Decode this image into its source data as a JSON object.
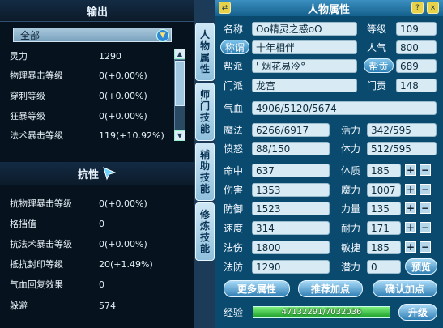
{
  "output_panel": {
    "title": "输出",
    "dropdown": "全部",
    "rows": [
      {
        "label": "灵力",
        "value": "1290"
      },
      {
        "label": "物理暴击等级",
        "value": "0(+0.00%)"
      },
      {
        "label": "穿刺等级",
        "value": "0(+0.00%)"
      },
      {
        "label": "狂暴等级",
        "value": "0(+0.00%)"
      },
      {
        "label": "法术暴击等级",
        "value": "119(+10.92%)"
      }
    ]
  },
  "defense_panel": {
    "title": "抗性",
    "rows": [
      {
        "label": "抗物理暴击等级",
        "value": "0(+0.00%)"
      },
      {
        "label": "格挡值",
        "value": "0"
      },
      {
        "label": "抗法术暴击等级",
        "value": "0(+0.00%)"
      },
      {
        "label": "抵抗封印等级",
        "value": "20(+1.49%)"
      },
      {
        "label": "气血回复效果",
        "value": "0"
      },
      {
        "label": "躲避",
        "value": "574"
      }
    ]
  },
  "side_tabs": [
    "人物属性",
    "师门技能",
    "辅助技能",
    "修炼技能"
  ],
  "window": {
    "title": "人物属性",
    "swap_icon": "⇄",
    "help_icon": "?",
    "close_icon": "×",
    "name_label": "名称",
    "name_value": "Oo精灵之惑oO",
    "level_label": "等级",
    "level_value": "109",
    "title_btn": "称谓",
    "title_value": "十年相伴",
    "popularity_label": "人气",
    "popularity_value": "800",
    "guild_label": "帮派",
    "guild_value": "' 烟花易冷°",
    "guild_contrib_btn": "帮贡",
    "guild_contrib_value": "689",
    "sect_label": "门派",
    "sect_value": "龙宫",
    "sect_contrib_label": "门贡",
    "sect_contrib_value": "148",
    "hp_label": "气血",
    "hp_value": "4906/5120/5674",
    "mp_label": "魔法",
    "mp_value": "6266/6917",
    "vitality_label": "活力",
    "vitality_value": "342/595",
    "anger_label": "愤怒",
    "anger_value": "88/150",
    "stamina_label": "体力",
    "stamina_value": "512/595",
    "stats_left": [
      {
        "label": "命中",
        "value": "637"
      },
      {
        "label": "伤害",
        "value": "1353"
      },
      {
        "label": "防御",
        "value": "1523"
      },
      {
        "label": "速度",
        "value": "314"
      },
      {
        "label": "法伤",
        "value": "1800"
      },
      {
        "label": "法防",
        "value": "1290"
      }
    ],
    "stats_right": [
      {
        "label": "体质",
        "value": "185"
      },
      {
        "label": "魔力",
        "value": "1007"
      },
      {
        "label": "力量",
        "value": "135"
      },
      {
        "label": "耐力",
        "value": "171"
      },
      {
        "label": "敏捷",
        "value": "185"
      },
      {
        "label": "潜力",
        "value": "0"
      }
    ],
    "plus": "+",
    "minus": "−",
    "preview_btn": "预览",
    "more_btn": "更多属性",
    "recommend_btn": "推荐加点",
    "confirm_btn": "确认加点",
    "exp_label": "经验",
    "exp_value": "47132291/7032036",
    "exp_fill_fraction": 1.0,
    "levelup_btn": "升级"
  },
  "colors": {
    "window_bg": "#0a4a6e",
    "field_bg": "#d8ebf5",
    "button_blue": "#2f7fb5",
    "exp_green": "#1d9e2a"
  }
}
